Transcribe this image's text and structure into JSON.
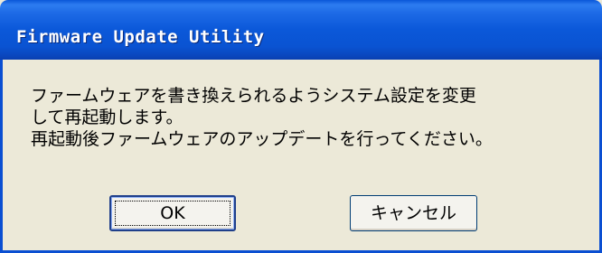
{
  "window": {
    "title": "Firmware Update Utility"
  },
  "message": {
    "lines": [
      "ファームウェアを書き換えられるようシステム設定を変更",
      "して再起動します。",
      "再起動後ファームウェアのアップデートを行ってください。"
    ]
  },
  "buttons": {
    "ok_label": "OK",
    "cancel_label": "キャンセル"
  },
  "colors": {
    "titlebar": "#0b58d9",
    "dialog_background": "#ece9d8",
    "button_border": "#003c74"
  }
}
